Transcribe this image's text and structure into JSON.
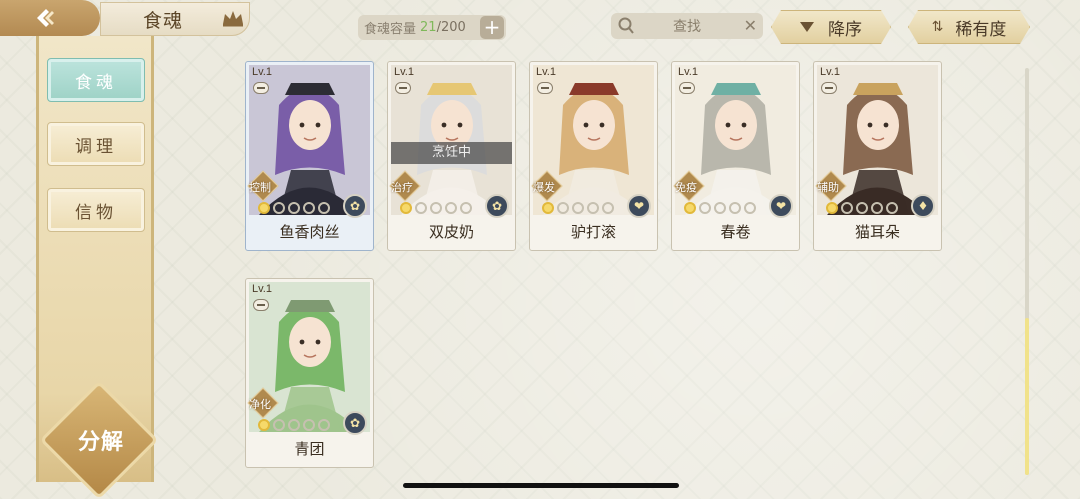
{
  "header": {
    "title": "食魂",
    "capacity_label": "食魂容量",
    "capacity_used": "21",
    "capacity_total": "/200",
    "search_placeholder": "查找",
    "sort_order_label": "降序",
    "sort_by_label": "稀有度"
  },
  "sidebar": {
    "items": [
      {
        "label": "食魂",
        "active": true
      },
      {
        "label": "调理",
        "active": false
      },
      {
        "label": "信物",
        "active": false
      }
    ],
    "decompose_label": "分解"
  },
  "cards": [
    {
      "level": "Lv.1",
      "name": "鱼香肉丝",
      "role": "控制",
      "stars_lit": 1,
      "stars_total": 5,
      "element": "flower",
      "status": "",
      "selected": true,
      "palette": {
        "bg": "#c9c6d6",
        "hair": "#7a5ea8",
        "cloth": "#2a2a36",
        "hat": "#2c2c34"
      }
    },
    {
      "level": "Lv.1",
      "name": "双皮奶",
      "role": "治疗",
      "stars_lit": 1,
      "stars_total": 5,
      "element": "flower",
      "status": "烹饪中",
      "selected": false,
      "palette": {
        "bg": "#e8e2d6",
        "hair": "#dcdcdc",
        "cloth": "#f4f0ea",
        "hat": "#e6c774"
      }
    },
    {
      "level": "Lv.1",
      "name": "驴打滚",
      "role": "爆发",
      "stars_lit": 1,
      "stars_total": 5,
      "element": "heart",
      "status": "",
      "selected": false,
      "palette": {
        "bg": "#efe6d4",
        "hair": "#d9b27a",
        "cloth": "#f1ebe0",
        "hat": "#8a3a2a"
      }
    },
    {
      "level": "Lv.1",
      "name": "春卷",
      "role": "免疫",
      "stars_lit": 1,
      "stars_total": 5,
      "element": "heart",
      "status": "",
      "selected": false,
      "palette": {
        "bg": "#f1ece0",
        "hair": "#b9b7ac",
        "cloth": "#f4f2ec",
        "hat": "#6fb0a4"
      }
    },
    {
      "level": "Lv.1",
      "name": "猫耳朵",
      "role": "辅助",
      "stars_lit": 1,
      "stars_total": 5,
      "element": "drop",
      "status": "",
      "selected": false,
      "palette": {
        "bg": "#ece6da",
        "hair": "#8a6a52",
        "cloth": "#3a2c26",
        "hat": "#c9a35e"
      }
    },
    {
      "level": "Lv.1",
      "name": "青团",
      "role": "净化",
      "stars_lit": 1,
      "stars_total": 5,
      "element": "flower",
      "status": "",
      "selected": false,
      "palette": {
        "bg": "#d9e4d2",
        "hair": "#7bb86a",
        "cloth": "#9fc48c",
        "hat": "#7f9a72"
      }
    }
  ]
}
